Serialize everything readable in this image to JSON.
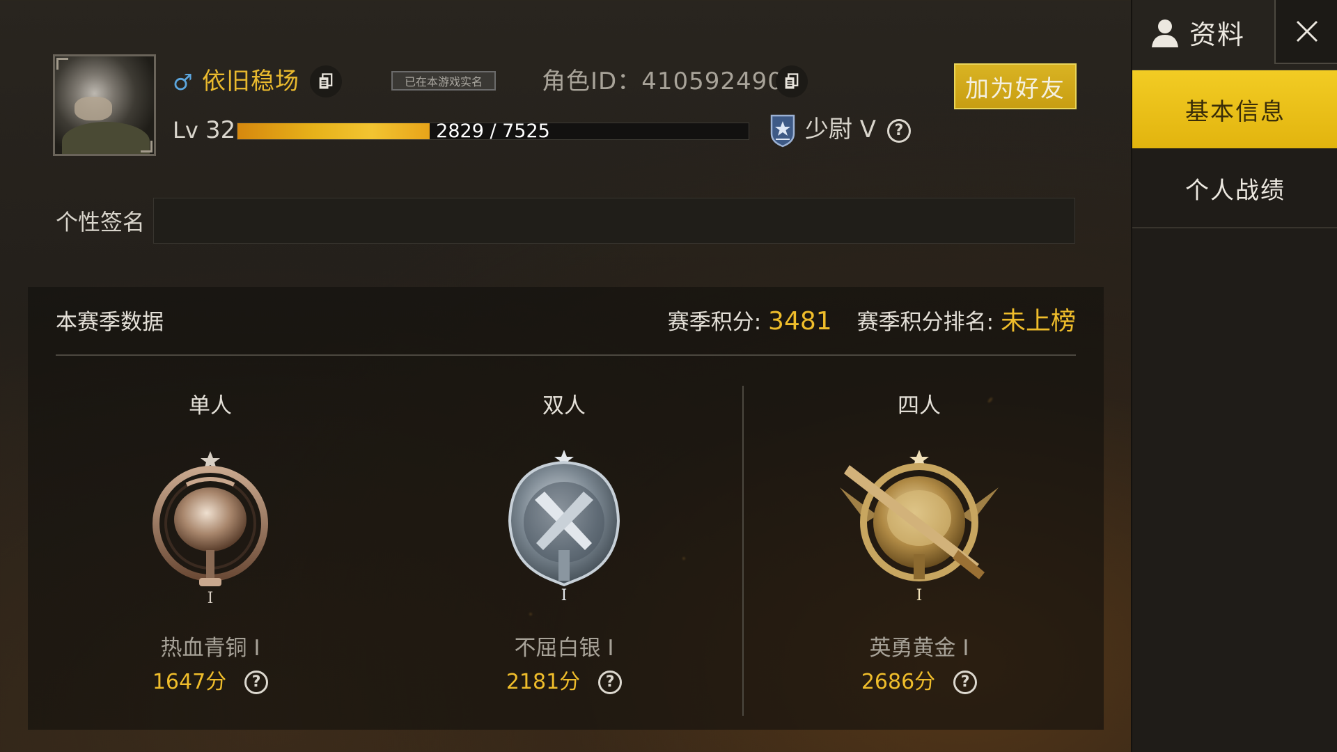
{
  "colors": {
    "accent_gold": "#efbd2b",
    "button_gold": "#d9b323",
    "male_blue": "#5ca6de",
    "text_light": "#e4e0d8",
    "text_muted": "#a7a298"
  },
  "profile": {
    "gender_symbol": "♂",
    "name": "依旧稳场",
    "verified_tag": "已在本游戏实名",
    "role_id_label": "角色ID：410592490",
    "add_friend_label": "加为好友",
    "level_prefix": "Lv",
    "level_value": "32",
    "xp_text": "2829 / 7525",
    "xp_progress": 0.376,
    "rank_name": "少尉 V",
    "help_glyph": "?"
  },
  "signature": {
    "label": "个性签名",
    "value": ""
  },
  "season": {
    "title": "本赛季数据",
    "points_label": "赛季积分: ",
    "points_value": "3481",
    "rank_label": "赛季积分排名: ",
    "rank_value": "未上榜",
    "modes": [
      {
        "title": "单人",
        "tier": "热血青铜 I",
        "score": "1647分",
        "medal_icon": "bronze-pan-medal-icon"
      },
      {
        "title": "双人",
        "tier": "不屈白银 I",
        "score": "2181分",
        "medal_icon": "silver-pistols-medal-icon"
      },
      {
        "title": "四人",
        "tier": "英勇黄金 I",
        "score": "2686分",
        "medal_icon": "gold-rifle-medal-icon"
      }
    ]
  },
  "sidebar": {
    "title": "资料",
    "close_icon": "close-icon",
    "tabs": [
      {
        "label": "基本信息",
        "active": true
      },
      {
        "label": "个人战绩",
        "active": false
      }
    ]
  }
}
